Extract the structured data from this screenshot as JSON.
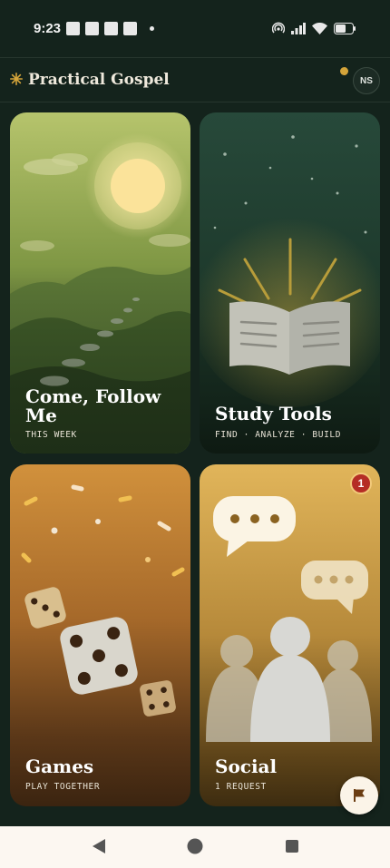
{
  "status_bar": {
    "time": "9:23"
  },
  "header": {
    "title": "Practical Gospel",
    "avatar_initials": "NS"
  },
  "cards": [
    {
      "title": "Come, Follow Me",
      "subtitle": "THIS WEEK"
    },
    {
      "title": "Study Tools",
      "subtitle": "FIND · ANALYZE · BUILD"
    },
    {
      "title": "Games",
      "subtitle": "PLAY TOGETHER"
    },
    {
      "title": "Social",
      "subtitle": "1 REQUEST",
      "badge": "1"
    }
  ],
  "colors": {
    "background": "#14231c",
    "accent_gold": "#d4a43a",
    "badge_red": "#b52d25"
  }
}
